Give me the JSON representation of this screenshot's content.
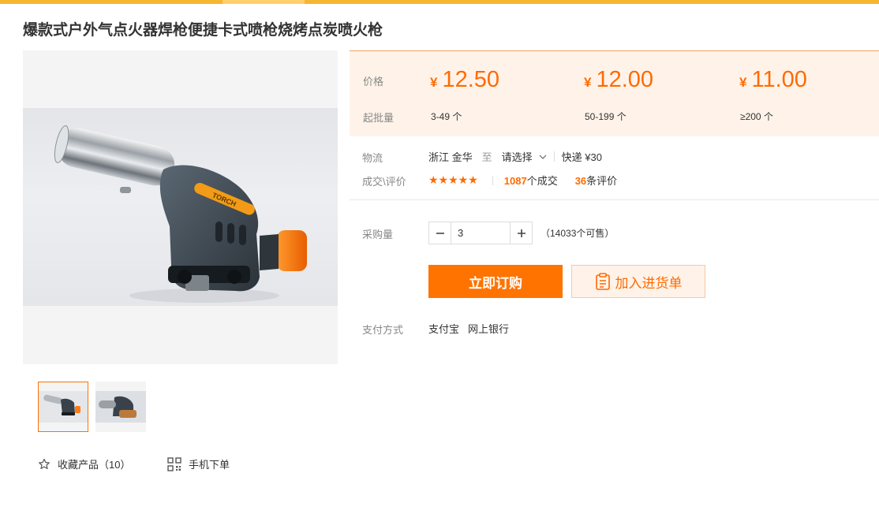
{
  "header": {
    "title": "爆款式户外气点火器焊枪便捷卡式喷枪烧烤点炭喷火枪"
  },
  "gallery": {
    "main_alt": "torch lighter product photo",
    "product_print": "TORCH",
    "thumbnails": [
      "thumb-1",
      "thumb-2"
    ],
    "active_index": 0
  },
  "gallery_actions": {
    "favorite_label": "收藏产品（10）",
    "mobile_order_label": "手机下单",
    "favorite_icon": "star-outline-icon",
    "mobile_icon": "qr-code-icon"
  },
  "pricing": {
    "price_label": "价格",
    "moq_label": "起批量",
    "currency": "¥",
    "tiers": [
      {
        "price": "12.50",
        "range": "3-49 个"
      },
      {
        "price": "12.00",
        "range": "50-199 个"
      },
      {
        "price": "11.00",
        "range": "≥200 个"
      }
    ],
    "accent_color": "#ff6a00",
    "box_bg": "#fff3e9"
  },
  "logistics": {
    "label": "物流",
    "origin": "浙江 金华",
    "to": "至",
    "destination": "请选择",
    "shipping": "快递 ¥30"
  },
  "deals": {
    "label": "成交\\评价",
    "stars": "★★★★★",
    "rating": 5,
    "deal_count": "1087",
    "deal_suffix": "个成交",
    "review_count": "36",
    "review_suffix": "条评价"
  },
  "purchase": {
    "qty_label": "采购量",
    "quantity": "3",
    "available": "（14033个可售）",
    "buy_label": "立即订购",
    "cart_label": "加入进货单"
  },
  "payment": {
    "label": "支付方式",
    "methods": [
      "支付宝",
      "网上银行"
    ]
  }
}
